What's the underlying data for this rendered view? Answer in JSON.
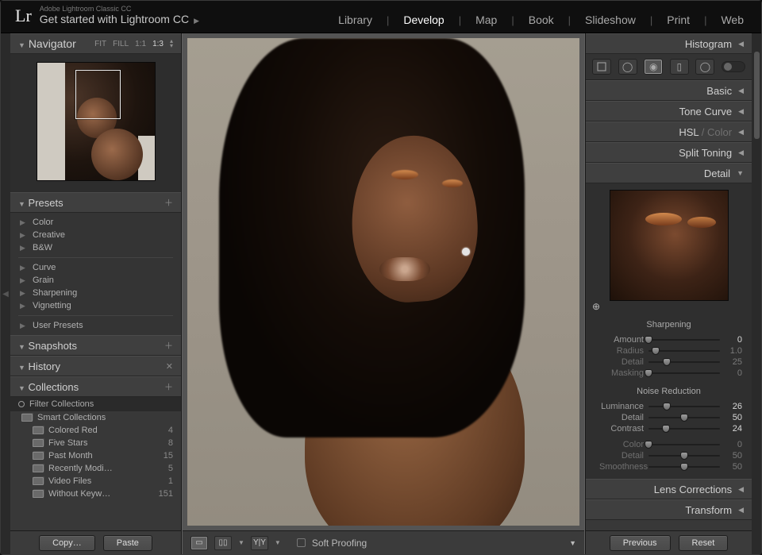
{
  "header": {
    "product_line": "Adobe Lightroom Classic CC",
    "tagline": "Get started with Lightroom CC",
    "modules": [
      "Library",
      "Develop",
      "Map",
      "Book",
      "Slideshow",
      "Print",
      "Web"
    ],
    "active_module": "Develop"
  },
  "left": {
    "navigator": {
      "title": "Navigator",
      "fit": "FIT",
      "fill": "FILL",
      "one_to_one": "1:1",
      "ratio": "1:3",
      "crop_rect": {
        "left_pct": 33,
        "top_pct": 6,
        "width_pct": 38,
        "height_pct": 42
      }
    },
    "presets": {
      "title": "Presets",
      "groups": [
        [
          "Color",
          "Creative",
          "B&W"
        ],
        [
          "Curve",
          "Grain",
          "Sharpening",
          "Vignetting"
        ],
        [
          "User Presets"
        ]
      ]
    },
    "snapshots": {
      "title": "Snapshots"
    },
    "history": {
      "title": "History"
    },
    "collections": {
      "title": "Collections",
      "filter_label": "Filter Collections",
      "root": "Smart Collections",
      "items": [
        {
          "name": "Colored Red",
          "count": 4
        },
        {
          "name": "Five Stars",
          "count": 8
        },
        {
          "name": "Past Month",
          "count": 15
        },
        {
          "name": "Recently Modi…",
          "count": 5
        },
        {
          "name": "Video Files",
          "count": 1
        },
        {
          "name": "Without Keyw…",
          "count": 151
        }
      ]
    },
    "buttons": {
      "copy": "Copy…",
      "paste": "Paste"
    }
  },
  "center": {
    "soft_proofing": "Soft Proofing"
  },
  "right": {
    "histogram": "Histogram",
    "panels": {
      "basic": "Basic",
      "tone_curve": "Tone Curve",
      "hsl": "HSL",
      "color_suffix": " / Color",
      "split_toning": "Split Toning",
      "detail": "Detail",
      "lens_corrections": "Lens Corrections",
      "transform": "Transform"
    },
    "detail": {
      "sharpen_label": "Sharpening",
      "sharpen": [
        {
          "name": "Amount",
          "value": 0,
          "pct": 0,
          "hint": true
        },
        {
          "name": "Radius",
          "value": "1.0",
          "pct": 10,
          "dim": true
        },
        {
          "name": "Detail",
          "value": 25,
          "pct": 25,
          "dim": true
        },
        {
          "name": "Masking",
          "value": 0,
          "pct": 0,
          "dim": true
        }
      ],
      "nr_label": "Noise Reduction",
      "nr": [
        {
          "name": "Luminance",
          "value": 26,
          "pct": 26
        },
        {
          "name": "Detail",
          "value": 50,
          "pct": 50
        },
        {
          "name": "Contrast",
          "value": 24,
          "pct": 24
        },
        {
          "name": "Color",
          "value": 0,
          "pct": 0,
          "gap": true,
          "dim": true
        },
        {
          "name": "Detail",
          "value": 50,
          "pct": 50,
          "dim": true
        },
        {
          "name": "Smoothness",
          "value": 50,
          "pct": 50,
          "dim": true
        }
      ]
    },
    "buttons": {
      "previous": "Previous",
      "reset": "Reset"
    }
  }
}
